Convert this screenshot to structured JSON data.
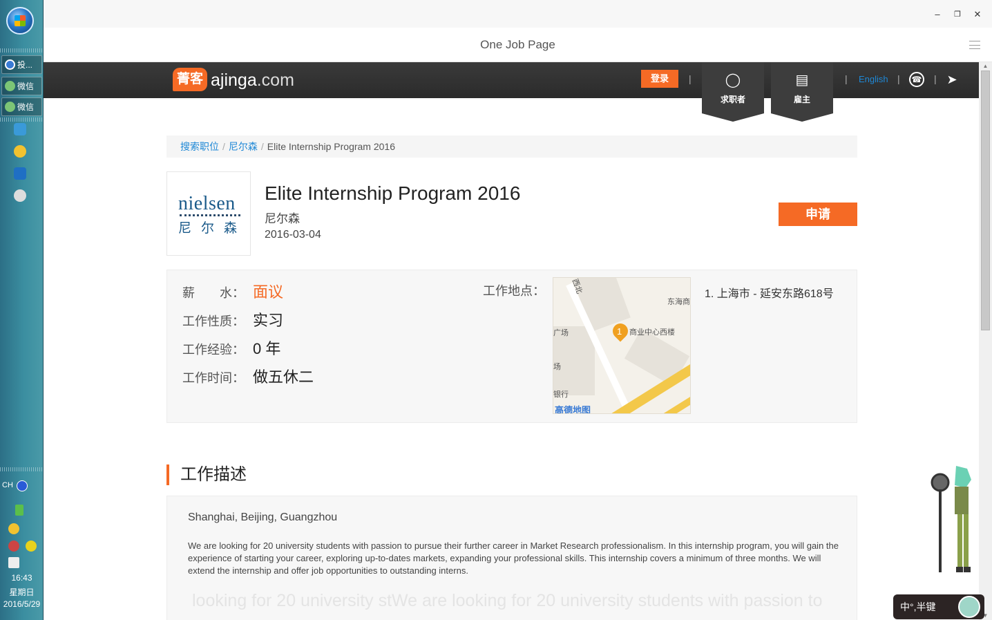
{
  "window": {
    "title": "One Job Page",
    "controls": [
      "minimize",
      "restore",
      "close"
    ]
  },
  "taskbar": {
    "tasks": [
      {
        "label": "投...",
        "icon": "qq-icon"
      },
      {
        "label": "微信",
        "icon": "wechat-icon"
      },
      {
        "label": "微信",
        "icon": "wechat-icon"
      }
    ],
    "tray": {
      "lang": "CH",
      "time": "16:43",
      "weekday": "星期日",
      "date": "2016/5/29"
    }
  },
  "site": {
    "logo_badge": "菁客",
    "logo_name": "ajinga",
    "logo_domain": ".com",
    "login": "登录",
    "tab_jobseeker": "求职者",
    "tab_employer": "雇主",
    "lang": "English",
    "sep": "|"
  },
  "breadcrumb": {
    "items": [
      "搜索职位",
      "尼尔森"
    ],
    "current": "Elite Internship Program 2016",
    "sep": "/"
  },
  "company_logo": {
    "en": "nielsen",
    "zh": "尼尔森"
  },
  "job": {
    "title": "Elite Internship Program 2016",
    "company": "尼尔森",
    "date": "2016-03-04",
    "apply": "申请"
  },
  "details": {
    "salary_label": "薪　　水：",
    "salary": "面议",
    "type_label": "工作性质：",
    "type": "实习",
    "exp_label": "工作经验：",
    "exp": "0 年",
    "time_label": "工作时间：",
    "time": "做五休二",
    "location_label": "工作地点：",
    "address": "1. 上海市 - 延安东路618号"
  },
  "map": {
    "labels": [
      "东海商",
      "商业中心西楼",
      "广场",
      "场",
      "银行",
      "西北"
    ],
    "pin": "1",
    "brand": "高德地图"
  },
  "description": {
    "heading": "工作描述",
    "city": "Shanghai, Beijing, Guangzhou",
    "body": "We are looking for 20 university students with passion to pursue their further career in Market Research professionalism.  In this internship program,  you will gain the experience of starting your career, exploring up-to-dates markets, expanding your professional skills.  This internship covers a minimum of three months.  We will extend the internship and offer job opportunities to outstanding interns.",
    "ghost": "looking for 20 university stWe are looking for 20 university students with passion to"
  },
  "ime": {
    "label": "中°,半键"
  },
  "colors": {
    "accent": "#f56a25",
    "link": "#1e88d6",
    "header": "#2f2f2f"
  }
}
